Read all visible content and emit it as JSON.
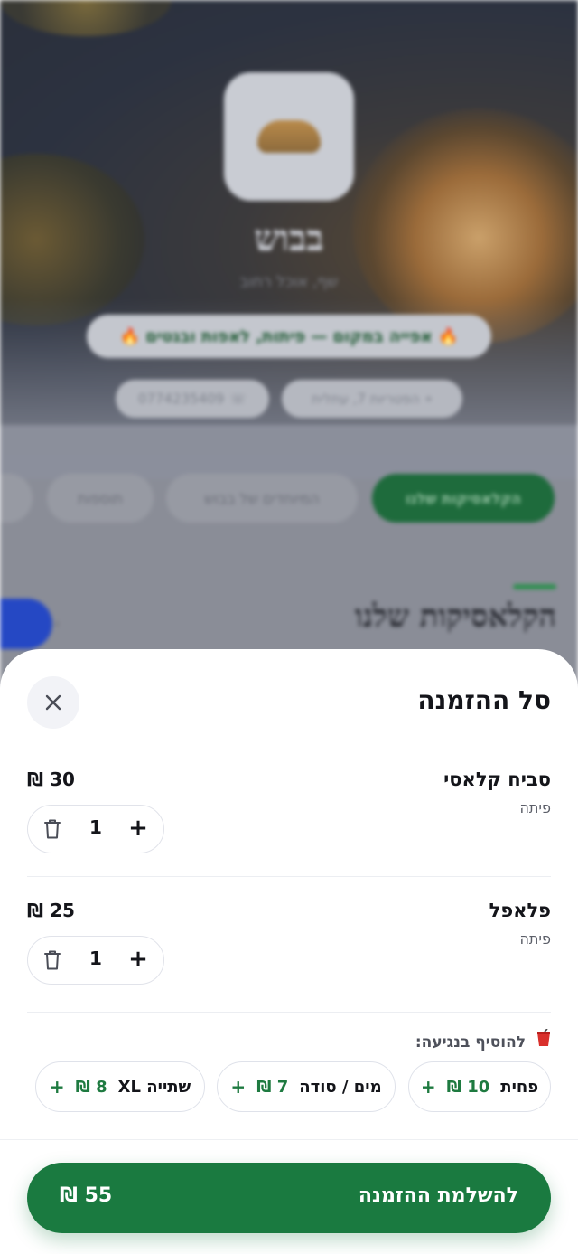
{
  "background": {
    "restaurant_name": "בבוש",
    "restaurant_subtitle": "שף, אוכל רחוב",
    "promo": "🔥 אפייה במקום — פיתות, לאפות ובגטים 🔥",
    "address": "הפטריות 7, עתלית",
    "phone": "0774235409",
    "categories": [
      "הקלאסיקות שלנו",
      "המיוחדים של בבוש",
      "תוספות"
    ],
    "section_title": "הקלאסיקות שלנו"
  },
  "cart": {
    "title": "סל ההזמנה",
    "items": [
      {
        "name": "סביח קלאסי",
        "variant": "פיתה",
        "price": "30 ₪",
        "quantity": "1",
        "plus": "+"
      },
      {
        "name": "פלאפל",
        "variant": "פיתה",
        "price": "25 ₪",
        "quantity": "1",
        "plus": "+"
      }
    ],
    "addons_heading": "להוסיף בנגיעה:",
    "addons": [
      {
        "name": "פחית",
        "price": "10 ₪",
        "plus": "+"
      },
      {
        "name": "מים / סודה",
        "price": "7 ₪",
        "plus": "+"
      },
      {
        "name": "שתייה XL",
        "price": "8 ₪",
        "plus": "+"
      }
    ],
    "checkout_label": "להשלמת ההזמנה",
    "checkout_total": "55 ₪"
  },
  "icons": {
    "close": "close-icon",
    "trash": "trash-icon",
    "cup": "cup-icon",
    "pin": "pin-icon",
    "phone": "phone-icon"
  },
  "colors": {
    "primary_green": "#1a7a40",
    "text_dark": "#14151a"
  }
}
